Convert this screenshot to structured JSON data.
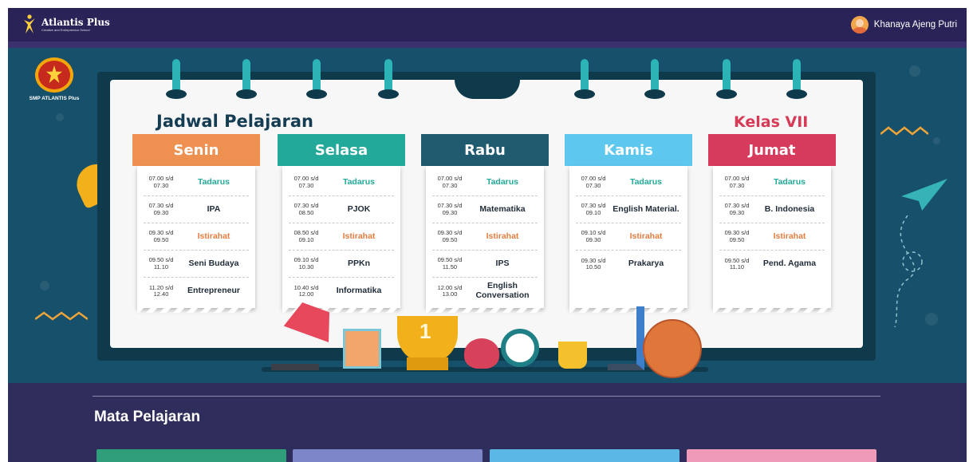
{
  "navbar": {
    "brand_name": "Atlantis Plus",
    "brand_tagline": "Creative and Entrepreneur School",
    "user_name": "Khanaya Ajeng Putri"
  },
  "hero": {
    "school_label": "SMP ATLANTIS Plus",
    "schedule_title": "Jadwal Pelajaran",
    "class_title": "Kelas VII",
    "days": [
      {
        "name": "Senin",
        "color": "#ee9150",
        "slots": [
          {
            "time": "07.00 s/d 07.30",
            "subject": "Tadarus",
            "kind": "tadarus"
          },
          {
            "time": "07.30 s/d 09.30",
            "subject": "IPA",
            "kind": "normal"
          },
          {
            "time": "09.30 s/d 09.50",
            "subject": "Istirahat",
            "kind": "istirahat"
          },
          {
            "time": "09.50 s/d 11.10",
            "subject": "Seni Budaya",
            "kind": "normal"
          },
          {
            "time": "11.20 s/d 12.40",
            "subject": "Entrepreneur",
            "kind": "normal"
          }
        ]
      },
      {
        "name": "Selasa",
        "color": "#23a99a",
        "slots": [
          {
            "time": "07.00 s/d 07.30",
            "subject": "Tadarus",
            "kind": "tadarus"
          },
          {
            "time": "07.30 s/d 08.50",
            "subject": "PJOK",
            "kind": "normal"
          },
          {
            "time": "08.50 s/d 09.10",
            "subject": "Istirahat",
            "kind": "istirahat"
          },
          {
            "time": "09.10 s/d 10.30",
            "subject": "PPKn",
            "kind": "normal"
          },
          {
            "time": "10.40 s/d 12.00",
            "subject": "Informatika",
            "kind": "normal"
          }
        ]
      },
      {
        "name": "Rabu",
        "color": "#1f5a6e",
        "slots": [
          {
            "time": "07.00 s/d 07.30",
            "subject": "Tadarus",
            "kind": "tadarus"
          },
          {
            "time": "07.30 s/d 09.30",
            "subject": "Matematika",
            "kind": "normal"
          },
          {
            "time": "09.30 s/d 09.50",
            "subject": "Istirahat",
            "kind": "istirahat"
          },
          {
            "time": "09.50 s/d 11.50",
            "subject": "IPS",
            "kind": "normal"
          },
          {
            "time": "12.00 s/d 13.00",
            "subject": "English Conversation",
            "kind": "normal"
          }
        ]
      },
      {
        "name": "Kamis",
        "color": "#5ec7ee",
        "slots": [
          {
            "time": "07.00 s/d 07.30",
            "subject": "Tadarus",
            "kind": "tadarus"
          },
          {
            "time": "07.30 s/d 09.10",
            "subject": "English Material.",
            "kind": "normal"
          },
          {
            "time": "09.10 s/d 09.30",
            "subject": "Istirahat",
            "kind": "istirahat"
          },
          {
            "time": "09.30 s/d 10.50",
            "subject": "Prakarya",
            "kind": "normal"
          }
        ]
      },
      {
        "name": "Jumat",
        "color": "#d63a5c",
        "slots": [
          {
            "time": "07.00 s/d 07.30",
            "subject": "Tadarus",
            "kind": "tadarus"
          },
          {
            "time": "07.30 s/d 09.30",
            "subject": "B. Indonesia",
            "kind": "normal"
          },
          {
            "time": "09.30 s/d 09.50",
            "subject": "Istirahat",
            "kind": "istirahat"
          },
          {
            "time": "09.50 s/d 11.10",
            "subject": "Pend. Agama",
            "kind": "normal"
          }
        ]
      }
    ],
    "trophy_number": "1"
  },
  "subjects_section": {
    "title": "Mata Pelajaran",
    "tile_colors": [
      "#2f9e7a",
      "#7d86c9",
      "#5ab7e6",
      "#ee9ab8"
    ]
  },
  "colors": {
    "navbar_bg": "#2a2358",
    "hero_bg": "#17506a",
    "section_bg": "#2e2d5c"
  }
}
